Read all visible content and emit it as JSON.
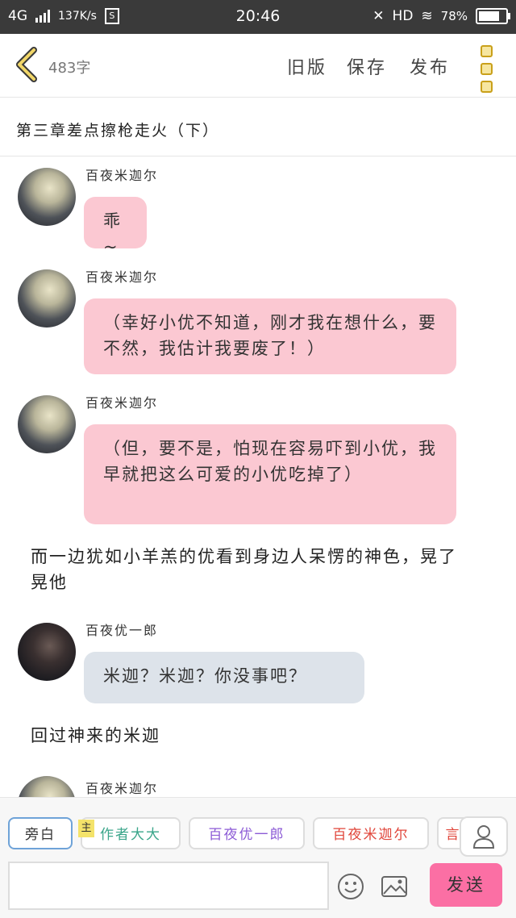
{
  "status_bar": {
    "network": "4G",
    "speed": "137K/s",
    "time": "20:46",
    "hd": "HD",
    "battery": "78%"
  },
  "header": {
    "word_count": "483字",
    "old_version": "旧版",
    "save": "保存",
    "publish": "发布"
  },
  "chapter": {
    "title": "第三章差点擦枪走火（下）"
  },
  "messages": [
    {
      "type": "chat",
      "name": "百夜米迦尔",
      "text": "乖~"
    },
    {
      "type": "chat",
      "name": "百夜米迦尔",
      "text": "（幸好小优不知道，刚才我在想什么，要不然，我估计我要废了！）"
    },
    {
      "type": "chat",
      "name": "百夜米迦尔",
      "text": "（但，要不是，怕现在容易吓到小优，我早就把这么可爱的小优吃掉了）"
    },
    {
      "type": "narration",
      "text": "而一边犹如小羊羔的优看到身边人呆愣的神色，晃了晃他"
    },
    {
      "type": "chat",
      "name": "百夜优一郎",
      "text": "米迦？米迦？你没事吧？"
    },
    {
      "type": "narration",
      "text": "回过神来的米迦"
    },
    {
      "type": "chat",
      "name": "百夜米迦尔",
      "text": ""
    }
  ],
  "roles": {
    "narrator": "旁白",
    "main_tag": "主",
    "author": "作者大大",
    "yuu": "百夜优一郎",
    "mika": "百夜米迦尔",
    "partial": "言"
  },
  "input": {
    "placeholder": "",
    "send": "发送"
  },
  "colors": {
    "mika_bubble": "#fbc8d2",
    "yuu_bubble": "#dde3ea",
    "send_button": "#fb6fa4",
    "back_icon": "#c9a01a",
    "author_text": "#3aa58a",
    "yuu_text": "#8c5bd6",
    "mika_text": "#e0453a"
  }
}
